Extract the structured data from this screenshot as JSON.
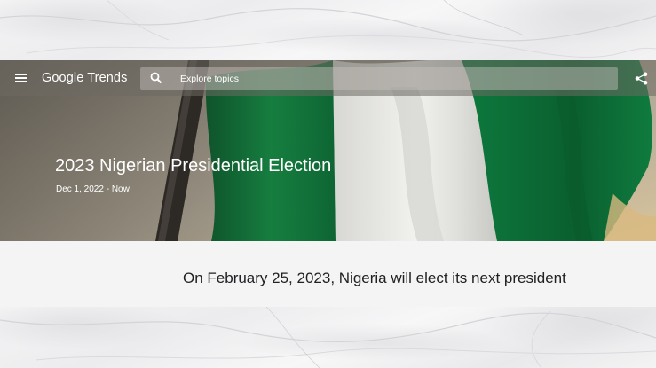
{
  "header": {
    "app_name": "Google Trends",
    "menu_icon": "hamburger-menu-icon",
    "search": {
      "placeholder": "Explore topics",
      "value": "",
      "icon": "search-icon"
    },
    "share_icon": "share-icon"
  },
  "hero": {
    "title": "2023 Nigerian Presidential Election",
    "date_range": "Dec 1, 2022 - Now",
    "image_subject": "Nigerian flag",
    "colors": {
      "flag_green": "#0b7a3b",
      "flag_white": "#f2f2f0"
    }
  },
  "summary": {
    "headline": "On February 25, 2023, Nigeria will elect its next president"
  }
}
